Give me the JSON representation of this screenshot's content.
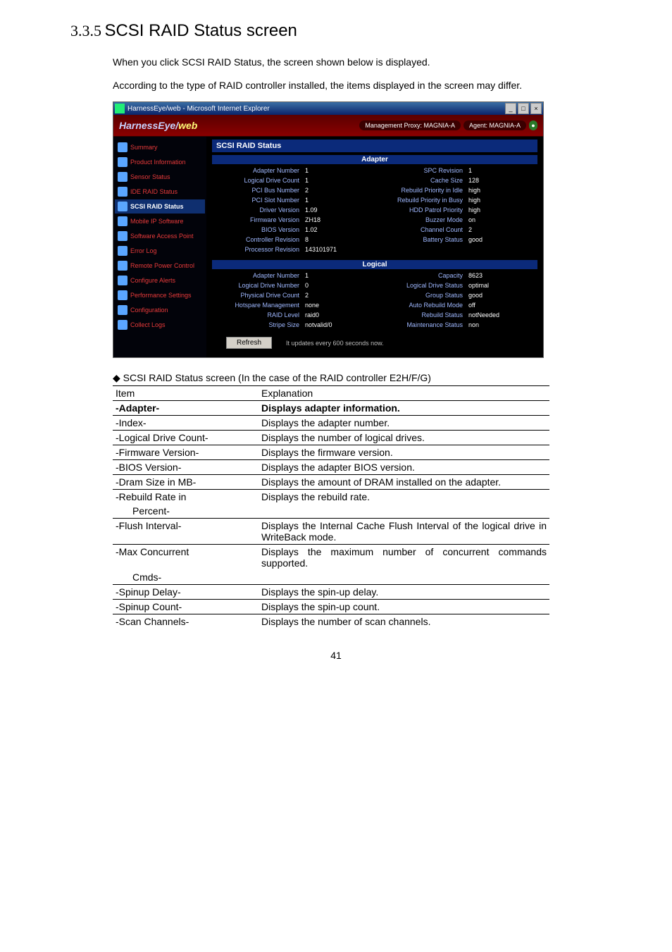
{
  "heading": {
    "num": "3.3.5",
    "title": "SCSI RAID Status screen"
  },
  "intro": [
    "When you click SCSI RAID Status, the screen shown below is displayed.",
    "According to the type of RAID controller installed, the items displayed in the screen may differ."
  ],
  "window": {
    "title": "HarnessEye/web - Microsoft Internet Explorer",
    "brand1": "HarnessEye/",
    "brand2": "web",
    "proxy": "Management Proxy: MAGNIA-A",
    "agent": "Agent: MAGNIA-A",
    "green": "●"
  },
  "sidebar": [
    "Summary",
    "Product Information",
    "Sensor Status",
    "IDE RAID Status",
    "SCSI RAID Status",
    "Mobile IP Software",
    "Software Access Point",
    "Error Log",
    "Remote Power Control",
    "Configure Alerts",
    "Performance Settings",
    "Configuration",
    "Collect Logs"
  ],
  "panel": {
    "title": "SCSI RAID Status",
    "adapter_head": "Adapter",
    "logical_head": "Logical"
  },
  "adapter_left": [
    {
      "k": "Adapter Number",
      "v": "1"
    },
    {
      "k": "Logical Drive Count",
      "v": "1"
    },
    {
      "k": "PCI Bus Number",
      "v": "2"
    },
    {
      "k": "PCI Slot Number",
      "v": "1"
    },
    {
      "k": "Driver Version",
      "v": "1.09"
    },
    {
      "k": "Firmware Version",
      "v": "ZH18"
    },
    {
      "k": "BIOS Version",
      "v": "1.02"
    },
    {
      "k": "Controller Revision",
      "v": "8"
    },
    {
      "k": "Processor Revision",
      "v": "143101971"
    }
  ],
  "adapter_right": [
    {
      "k": "SPC Revision",
      "v": "1"
    },
    {
      "k": "Cache Size",
      "v": "128"
    },
    {
      "k": "Rebuild Priority in Idle",
      "v": "high"
    },
    {
      "k": "Rebuild Priority in Busy",
      "v": "high"
    },
    {
      "k": "HDD Patrol Priority",
      "v": "high"
    },
    {
      "k": "Buzzer Mode",
      "v": "on"
    },
    {
      "k": "Channel Count",
      "v": "2"
    },
    {
      "k": "Battery Status",
      "v": "good"
    }
  ],
  "logical_left": [
    {
      "k": "Adapter Number",
      "v": "1"
    },
    {
      "k": "Logical Drive Number",
      "v": "0"
    },
    {
      "k": "Physical Drive Count",
      "v": "2"
    },
    {
      "k": "Hotspare Management",
      "v": "none"
    },
    {
      "k": "RAID Level",
      "v": "raid0"
    },
    {
      "k": "Stripe Size",
      "v": "notvalid/0"
    }
  ],
  "logical_right": [
    {
      "k": "Capacity",
      "v": "8623"
    },
    {
      "k": "Logical Drive Status",
      "v": "optimal"
    },
    {
      "k": "Group Status",
      "v": "good"
    },
    {
      "k": "Auto Rebuild Mode",
      "v": "off"
    },
    {
      "k": "Rebuild Status",
      "v": "notNeeded"
    },
    {
      "k": "Maintenance Status",
      "v": "non"
    }
  ],
  "refresh": {
    "btn": "Refresh",
    "note": "It updates every 600 seconds now."
  },
  "caption": "◆ SCSI RAID Status screen (In the case of the RAID controller E2H/F/G)",
  "table_head": {
    "c1": "Item",
    "c2": "Explanation"
  },
  "table": [
    {
      "item": "-Adapter-",
      "exp": "Displays adapter information.",
      "bold": true,
      "top": true
    },
    {
      "item": "-Index-",
      "exp": "Displays the adapter number.",
      "top": true
    },
    {
      "item": "-Logical Drive Count-",
      "exp": "Displays the number of logical drives.",
      "top": true
    },
    {
      "item": "-Firmware Version-",
      "exp": "Displays the firmware version.",
      "top": true
    },
    {
      "item": "-BIOS Version-",
      "exp": "Displays the adapter BIOS version.",
      "top": true
    },
    {
      "item": "-Dram Size in MB-",
      "exp": "Displays the amount of DRAM installed on the adapter.",
      "top": true
    },
    {
      "item": "-Rebuild Rate in",
      "exp": "Displays the rebuild rate.",
      "top": true
    },
    {
      "item": "Percent-",
      "exp": "",
      "sub": true
    },
    {
      "item": "-Flush Interval-",
      "exp": "Displays the Internal Cache Flush Interval of the logical drive in WriteBack mode.",
      "top": true
    },
    {
      "item": "-Max Concurrent",
      "exp": "Displays the maximum number of concurrent commands supported.",
      "top": true
    },
    {
      "item": "Cmds-",
      "exp": "",
      "sub": true
    },
    {
      "item": "-Spinup Delay-",
      "exp": "Displays the spin-up delay.",
      "top": true
    },
    {
      "item": "-Spinup Count-",
      "exp": "Displays the spin-up count.",
      "top": true
    },
    {
      "item": "-Scan Channels-",
      "exp": "Displays the number of scan channels.",
      "top": true
    }
  ],
  "pagenum": "41"
}
